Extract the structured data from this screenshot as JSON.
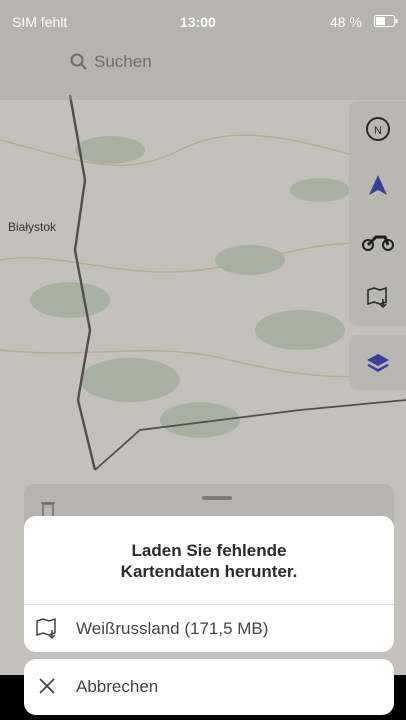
{
  "status_bar": {
    "carrier": "SIM fehlt",
    "time": "13:00",
    "battery": "48 %"
  },
  "search": {
    "placeholder": "Suchen"
  },
  "map": {
    "city_label": "Białystok"
  },
  "dialog": {
    "message": "Laden Sie fehlende\nKartendaten herunter.",
    "download_label": "Weißrussland (171,5 MB)",
    "cancel_label": "Abbrechen"
  },
  "side_buttons": [
    "compass-icon",
    "navigation-arrow-icon",
    "motorcycle-icon",
    "map-download-icon"
  ],
  "layers_button": "layers-icon"
}
